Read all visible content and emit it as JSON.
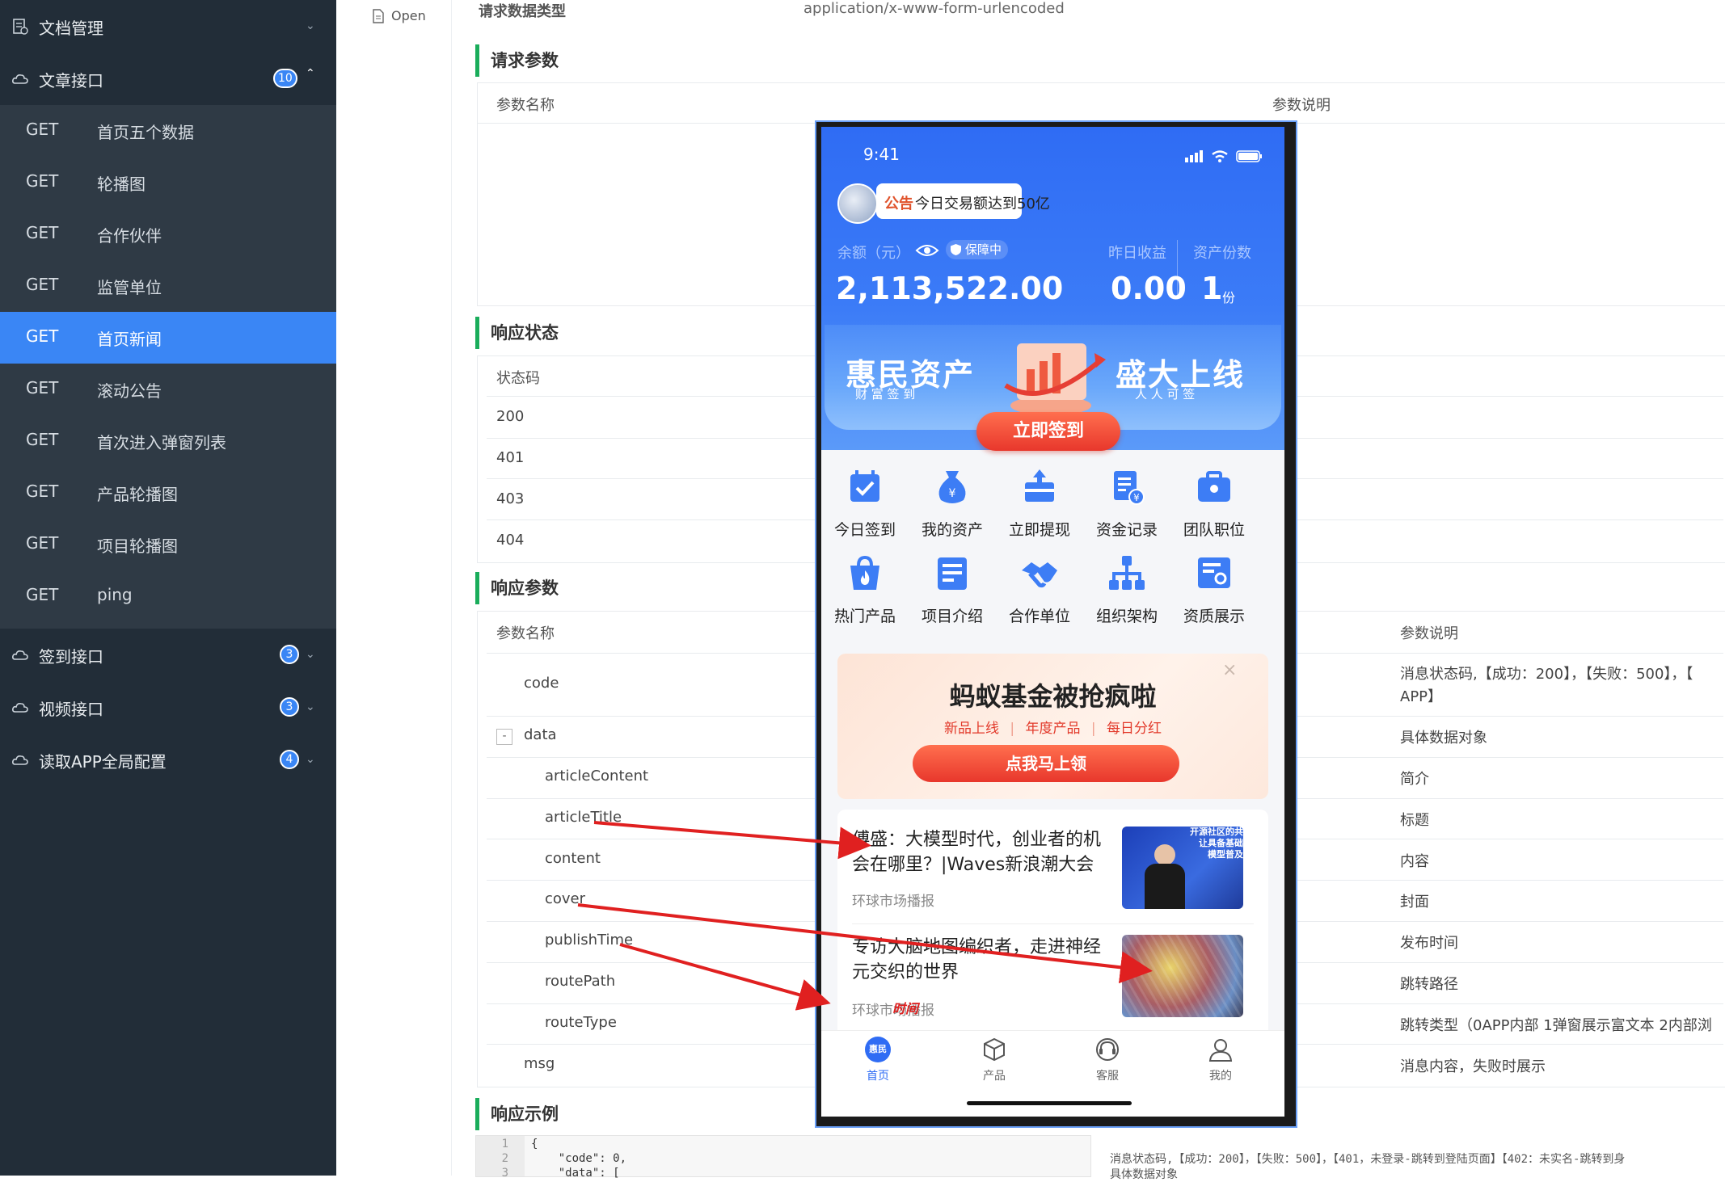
{
  "sidebar": {
    "groups": [
      {
        "label": "文档管理",
        "icon": "document-icon",
        "badge": null,
        "expanded": false
      },
      {
        "label": "文章接口",
        "icon": "cloud-icon",
        "badge": "10",
        "expanded": true
      },
      {
        "label": "签到接口",
        "icon": "cloud-icon",
        "badge": "3",
        "expanded": false
      },
      {
        "label": "视频接口",
        "icon": "cloud-icon",
        "badge": "3",
        "expanded": false
      },
      {
        "label": "读取APP全局配置",
        "icon": "cloud-icon",
        "badge": "4",
        "expanded": false
      }
    ],
    "items": [
      {
        "method": "GET",
        "label": "首页五个数据"
      },
      {
        "method": "GET",
        "label": "轮播图"
      },
      {
        "method": "GET",
        "label": "合作伙伴"
      },
      {
        "method": "GET",
        "label": "监管单位"
      },
      {
        "method": "GET",
        "label": "首页新闻",
        "active": true
      },
      {
        "method": "GET",
        "label": "滚动公告"
      },
      {
        "method": "GET",
        "label": "首次进入弹窗列表"
      },
      {
        "method": "GET",
        "label": "产品轮播图"
      },
      {
        "method": "GET",
        "label": "项目轮播图"
      },
      {
        "method": "GET",
        "label": "ping"
      }
    ]
  },
  "open_link": "Open",
  "doc": {
    "content_type_label": "请求数据类型",
    "content_type_value": "application/x-www-form-urlencoded",
    "request_params": {
      "title": "请求参数",
      "col_name": "参数名称",
      "col_desc": "参数说明"
    },
    "response_status": {
      "title": "响应状态",
      "col_code": "状态码",
      "codes": [
        "200",
        "401",
        "403",
        "404"
      ]
    },
    "response_params": {
      "title": "响应参数",
      "col_name": "参数名称",
      "col_desc": "参数说明",
      "rows": [
        {
          "name": "code",
          "desc": "消息状态码,【成功：200】，【失败：500】，【",
          "desc2": "APP】"
        },
        {
          "name": "data",
          "desc": "具体数据对象",
          "toggle": "-"
        },
        {
          "name": "articleContent",
          "desc": "简介"
        },
        {
          "name": "articleTitle",
          "desc": "标题"
        },
        {
          "name": "content",
          "desc": "内容"
        },
        {
          "name": "cover",
          "desc": "封面"
        },
        {
          "name": "publishTime",
          "desc": "发布时间"
        },
        {
          "name": "routePath",
          "desc": "跳转路径"
        },
        {
          "name": "routeType",
          "desc": "跳转类型（0APP内部 1弹窗展示富文本 2内部浏"
        },
        {
          "name": "msg",
          "desc": "消息内容，失败时展示"
        }
      ]
    },
    "response_example": {
      "title": "响应示例",
      "lines": [
        {
          "no": "1",
          "text": "{"
        },
        {
          "no": "2",
          "text": "    \"code\": 0,"
        },
        {
          "no": "3",
          "text": "    \"data\": ["
        }
      ],
      "side_text": "消息状态码,【成功：200】，【失败：500】，【401，未登录-跳转到登陆页面】【402：未实名-跳转到身",
      "side_text2": "具体数据对象"
    }
  },
  "phone": {
    "time": "9:41",
    "notice_tag": "公告",
    "notice_text": "今日交易额达到50亿",
    "balance_label": "余额（元）",
    "guard_badge": "保障中",
    "balance_value": "2,113,522.00",
    "yesterday_label": "昨日收益",
    "yesterday_value": "0.00",
    "shares_label": "资产份数",
    "shares_value": "1",
    "shares_unit": "份",
    "banner_left": "惠民资产",
    "banner_left_sub": "财 富 签 到",
    "banner_right": "盛大上线",
    "banner_right_sub": "人 人 可 签",
    "signin_button": "立即签到",
    "grid": [
      {
        "label": "今日签到",
        "icon": "calendar-check-icon"
      },
      {
        "label": "我的资产",
        "icon": "money-bag-icon"
      },
      {
        "label": "立即提现",
        "icon": "withdraw-icon"
      },
      {
        "label": "资金记录",
        "icon": "record-icon"
      },
      {
        "label": "团队职位",
        "icon": "briefcase-icon"
      },
      {
        "label": "热门产品",
        "icon": "hot-bag-icon"
      },
      {
        "label": "项目介绍",
        "icon": "document-icon"
      },
      {
        "label": "合作单位",
        "icon": "handshake-icon"
      },
      {
        "label": "组织架构",
        "icon": "org-chart-icon"
      },
      {
        "label": "资质展示",
        "icon": "certificate-icon"
      }
    ],
    "promo_title": "蚂蚁基金被抢疯啦",
    "promo_tags": [
      "新品上线",
      "年度产品",
      "每日分红"
    ],
    "promo_button": "点我马上领",
    "news": [
      {
        "title": "傅盛：大模型时代，创业者的机会在哪里？|Waves新浪潮大会",
        "source": "环球市场播报",
        "thumb_text": "开源社区的共\n让具备基础\n模型普及"
      },
      {
        "title": "专访大脑地图编织者，走进神经元交织的世界",
        "source": "环球市场播报",
        "thumb_text": ""
      }
    ],
    "annotation_label": "时间",
    "tabs": [
      {
        "label": "首页",
        "icon": "home-logo-icon",
        "logo_text": "惠民",
        "active": true
      },
      {
        "label": "产品",
        "icon": "box-icon"
      },
      {
        "label": "客服",
        "icon": "headset-icon"
      },
      {
        "label": "我的",
        "icon": "user-icon"
      }
    ],
    "annotation_color": "#e02020",
    "accent": "#2f6cf4"
  }
}
